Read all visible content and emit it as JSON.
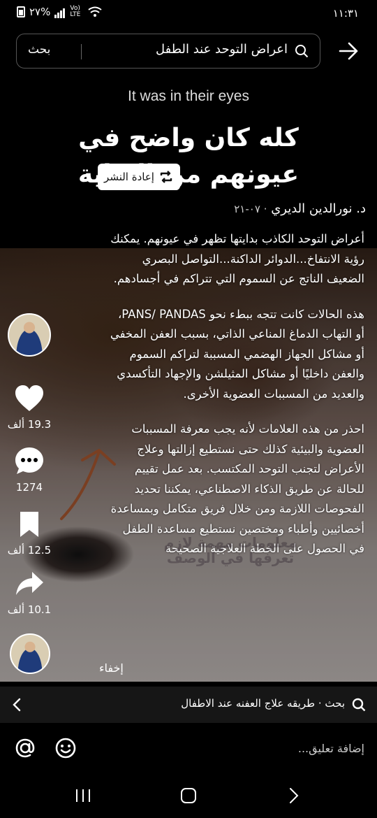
{
  "status_bar": {
    "time": "١١:٣١",
    "battery": "٢٧%",
    "network": "Vo) LTE"
  },
  "search": {
    "query": "اعراض التوحد عند الطفل",
    "button_label": "بحث"
  },
  "video": {
    "title_en": "It was in their eyes",
    "title_ar": "كله كان واضح في عيونهم من البداية",
    "repost_label": "إعادة النشر",
    "author": "د. نورالدين الديري",
    "date": "٠٧-٢١",
    "description": [
      "أعراض التوحد الكاذب بدايتها تظهر في عيونهم. يمكنك رؤية الانتفاخ...الدوائر الداكنة...التواصل البصري الضعيف الناتج عن السموم التي تتراكم في أجسادهم.",
      "هذه الحالات كانت تتجه ببطء نحو PANS/ PANDAS، أو التهاب الدماغ المناعي الذاتي، بسبب العفن المخفي أو مشاكل الجهاز الهضمي المسببة لتراكم السموم والعفن داخليًا أو مشاكل المثيلشن والإجهاد التأكسدي والعديد من المسببات العضوية الأخرى.",
      "احذر من هذه العلامات لأنه يجب معرفة المسببات العضوية والبيئية كذلك حتى نستطيع إزالتها وعلاج الأعراض لتجنب التوحد المكتسب. بعد عمل تقييم للحالة عن طريق الذكاء الاصطناعي، يمكننا تحديد الفحوصات اللازمة ومن خلال فريق متكامل وبمساعدة أخصائيين وأطباء ومختصين نستطيع مساعدة الطفل في الحصول على الخطة العلاجية الصحيحة"
    ],
    "watermark": "معلومات مهمة لازم تعرفها في الوصف",
    "hide_label": "إخفاء"
  },
  "actions": {
    "likes": "19.3 ألف",
    "comments": "1274",
    "saves": "12.5 ألف",
    "shares": "10.1 ألف"
  },
  "suggestion": {
    "text": "بحث · طريقه علاج العفنه عند الاطفال"
  },
  "comment_bar": {
    "placeholder": "إضافة تعليق..."
  },
  "icons": [
    "back-arrow-icon",
    "search-icon",
    "repost-icon",
    "heart-icon",
    "comment-icon",
    "bookmark-icon",
    "share-icon",
    "at-icon",
    "emoji-icon",
    "chevron-left-icon",
    "recents-icon",
    "home-icon",
    "back-icon"
  ]
}
